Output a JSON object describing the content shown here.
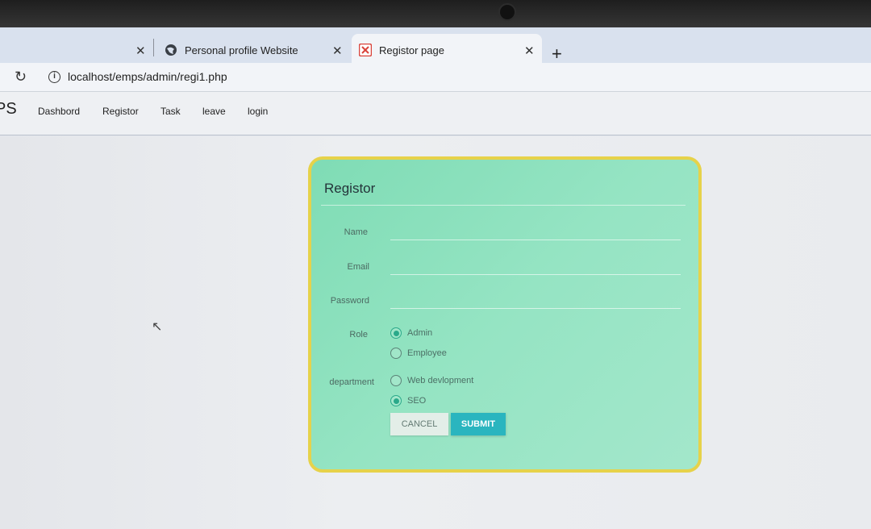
{
  "browser": {
    "tabs": [
      {
        "title": "Personal profile Website",
        "active": false
      },
      {
        "title": "Registor page",
        "active": true
      }
    ],
    "new_tab_symbol": "+",
    "close_symbol": "✕",
    "url": "localhost/emps/admin/regi1.php"
  },
  "app": {
    "brand": "PS",
    "nav": [
      "Dashbord",
      "Registor",
      "Task",
      "leave",
      "login"
    ]
  },
  "form": {
    "title": "Registor",
    "fields": {
      "name_label": "Name",
      "email_label": "Email",
      "password_label": "Password"
    },
    "role": {
      "label": "Role",
      "options": [
        "Admin",
        "Employee"
      ],
      "selected": "Admin"
    },
    "department": {
      "label": "department",
      "options": [
        "Web devlopment",
        "SEO"
      ],
      "selected": "SEO"
    },
    "cancel_label": "CANCEL",
    "submit_label": "SUBMIT"
  },
  "colors": {
    "card_bg": "#95e4c3",
    "card_border": "#e6d24a",
    "submit_bg": "#2ab5bf",
    "radio_accent": "#2aa98a"
  }
}
